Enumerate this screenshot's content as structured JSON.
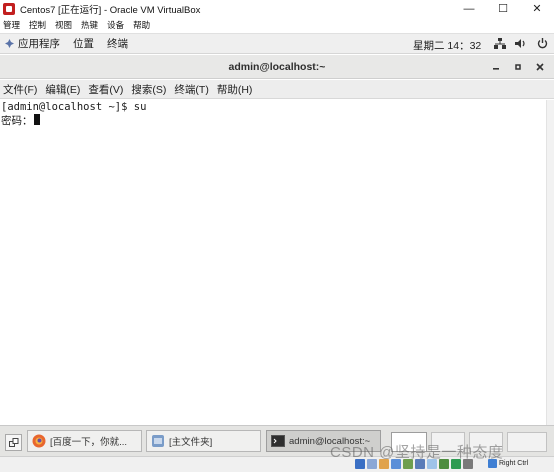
{
  "vbox": {
    "title": "Centos7 [正在运行] - Oracle VM VirtualBox",
    "window_buttons": [
      "—",
      "☐",
      "✕"
    ],
    "menu": [
      "管理",
      "控制",
      "视图",
      "热键",
      "设备",
      "帮助"
    ],
    "host_key": "Right Ctrl"
  },
  "gnome_top": {
    "applications": "应用程序",
    "places": "位置",
    "terminal": "终端",
    "clock": "星期二 14：32"
  },
  "terminal": {
    "title": "admin@localhost:~",
    "menu": [
      "文件(F)",
      "编辑(E)",
      "查看(V)",
      "搜索(S)",
      "终端(T)",
      "帮助(H)"
    ],
    "lines": [
      "[admin@localhost ~]$ su",
      "密码："
    ]
  },
  "taskbar": {
    "tasks": [
      "[百度一下，你就...",
      "[主文件夹]",
      "admin@localhost:~"
    ]
  },
  "watermark": "CSDN @坚持是一种态度",
  "colors": {
    "terminal_bg": "#ffffff",
    "panel_bg": "#e4e4e2",
    "topbar_bg": "#efefef",
    "vbox_icon": "#c21f1f",
    "firefox": "#e8662e",
    "files": "#7a9cc8"
  }
}
